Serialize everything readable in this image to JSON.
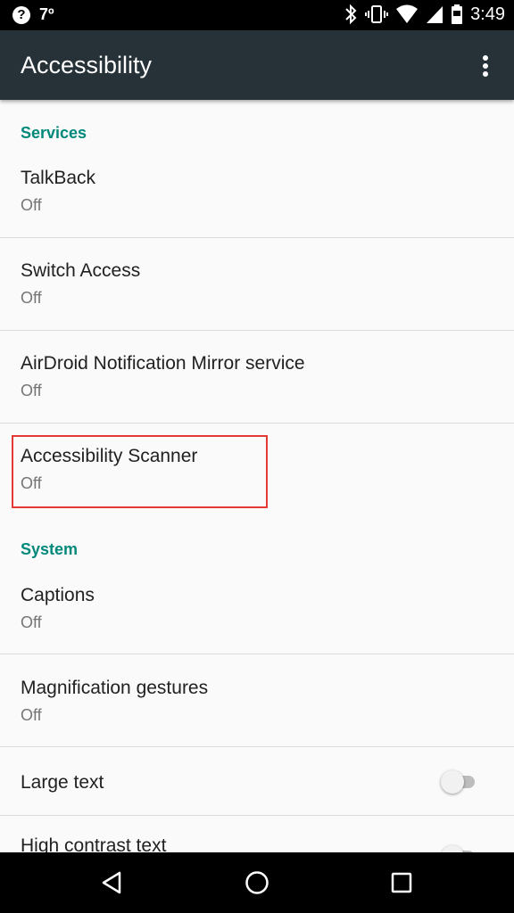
{
  "status_bar": {
    "temperature": "7º",
    "time": "3:49"
  },
  "app_bar": {
    "title": "Accessibility"
  },
  "sections": {
    "services": {
      "header": "Services",
      "items": [
        {
          "title": "TalkBack",
          "summary": "Off"
        },
        {
          "title": "Switch Access",
          "summary": "Off"
        },
        {
          "title": "AirDroid Notification Mirror service",
          "summary": "Off"
        },
        {
          "title": "Accessibility Scanner",
          "summary": "Off"
        }
      ]
    },
    "system": {
      "header": "System",
      "items": [
        {
          "title": "Captions",
          "summary": "Off"
        },
        {
          "title": "Magnification gestures",
          "summary": "Off"
        },
        {
          "title": "Large text",
          "toggle": false
        },
        {
          "title": "High contrast text",
          "toggle": false
        }
      ]
    }
  },
  "colors": {
    "accent": "#00897b",
    "app_bar": "#263238",
    "highlight": "#e53935"
  }
}
